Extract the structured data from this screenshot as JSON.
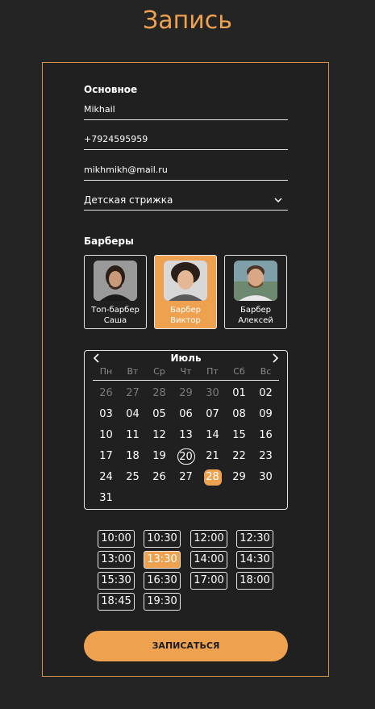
{
  "page": {
    "title": "Запись"
  },
  "form": {
    "section_main": "Основное",
    "name_value": "Mikhail",
    "phone_value": "+7924595959",
    "email_value": "mikhmikh@mail.ru",
    "service_value": "Детская стрижка",
    "section_barbers": "Барберы"
  },
  "barbers": [
    {
      "line1": "Топ-барбер",
      "line2": "Саша",
      "selected": false
    },
    {
      "line1": "Барбер",
      "line2": "Виктор",
      "selected": true
    },
    {
      "line1": "Барбер",
      "line2": "Алексей",
      "selected": false
    }
  ],
  "calendar": {
    "month": "Июль",
    "weekdays": [
      "Пн",
      "Вт",
      "Ср",
      "Чт",
      "Пт",
      "Сб",
      "Вс"
    ],
    "weeks": [
      [
        "26",
        "27",
        "28",
        "29",
        "30",
        "01",
        "02"
      ],
      [
        "03",
        "04",
        "05",
        "06",
        "07",
        "08",
        "09"
      ],
      [
        "10",
        "11",
        "12",
        "13",
        "14",
        "15",
        "16"
      ],
      [
        "17",
        "18",
        "19",
        "20",
        "21",
        "22",
        "23"
      ],
      [
        "24",
        "25",
        "26",
        "27",
        "28",
        "29",
        "30"
      ],
      [
        "31"
      ]
    ],
    "muted_days_first_week": 5,
    "today": "20",
    "selected_day": "28"
  },
  "times": [
    "10:00",
    "10:30",
    "12:00",
    "12:30",
    "13:00",
    "13:30",
    "14:00",
    "14:30",
    "15:30",
    "16:30",
    "17:00",
    "18:00",
    "18:45",
    "19:30"
  ],
  "selected_time": "13:30",
  "submit_label": "ЗАПИСАТЬСЯ",
  "colors": {
    "accent": "#eea14f",
    "background": "#242424",
    "border": "#e6e6e6"
  }
}
